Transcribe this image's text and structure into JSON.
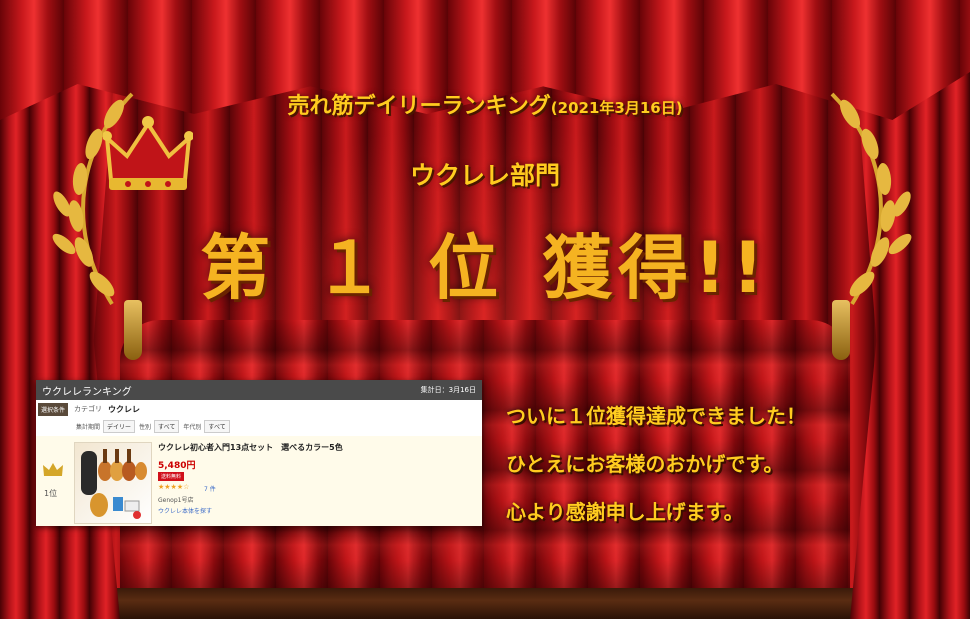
{
  "banner": {
    "subtitle": "売れ筋デイリーランキング",
    "subtitle_date": "(2021年3月16日)",
    "department": "ウクレレ部門",
    "headline_part1": "第",
    "headline_part2": "１",
    "headline_part3": "位",
    "headline_part4": "獲得!!"
  },
  "ranking_panel": {
    "title": "ウクレレランキング",
    "updated": "集計日：3月16日",
    "condition_badge": "選択条件",
    "category_label": "カテゴリ",
    "category_value": "ウクレレ",
    "filters": {
      "period_label": "集計期間",
      "period_value": "デイリー",
      "gender_label": "性別",
      "gender_value": "すべて",
      "age_label": "年代別",
      "age_value": "すべて"
    },
    "item": {
      "rank": "1位",
      "title": "ウクレレ初心者入門13点セット　選べるカラー5色",
      "price": "5,480円",
      "shipping_badge": "送料無料",
      "stars": "★★★★☆",
      "review_count": "7 件",
      "shop": "Genop1号店",
      "shop_link": "ウクレレ本体を探す"
    }
  },
  "message": {
    "line1": "ついに１位獲得達成できました！",
    "line2": "ひとえにお客様のおかげです。",
    "line3": "心より感謝申し上げます。"
  },
  "colors": {
    "gold_text": "#ffcc1f",
    "curtain_red": "#c81a1c",
    "price_red": "#cc0000"
  },
  "icons": [
    "crown-icon",
    "laurel-left-icon",
    "laurel-right-icon",
    "rank-crown-icon",
    "star-icon"
  ]
}
